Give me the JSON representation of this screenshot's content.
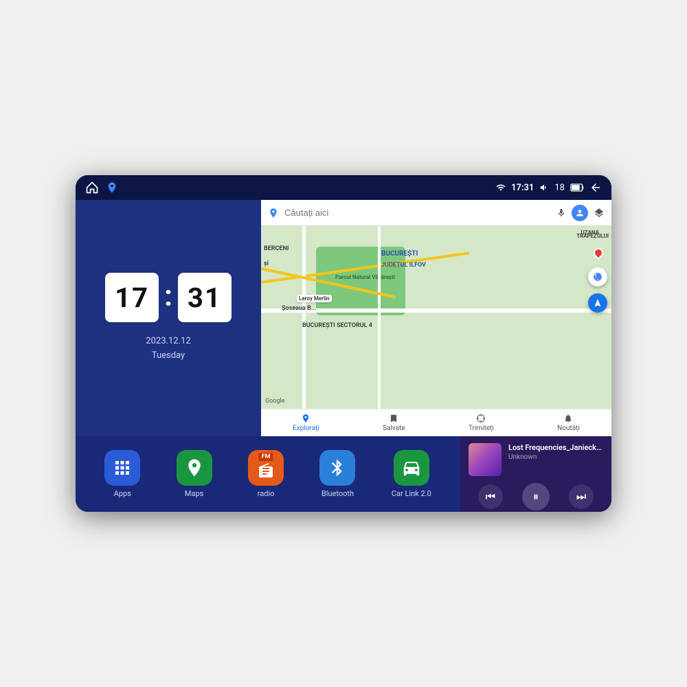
{
  "device": {
    "status_bar": {
      "time": "17:31",
      "signal_icon": "signal",
      "volume_icon": "volume",
      "battery_value": "18",
      "battery_icon": "battery",
      "back_icon": "back-arrow"
    },
    "clock": {
      "hours": "17",
      "minutes": "31",
      "date": "2023.12.12",
      "day": "Tuesday"
    },
    "map": {
      "search_placeholder": "Căutați aici",
      "bottom_items": [
        {
          "label": "Explorați",
          "icon": "pin",
          "active": true
        },
        {
          "label": "Salvate",
          "icon": "bookmark",
          "active": false
        },
        {
          "label": "Trimiteți",
          "icon": "share",
          "active": false
        },
        {
          "label": "Noutăți",
          "icon": "bell",
          "active": false
        }
      ]
    },
    "apps": [
      {
        "id": "apps",
        "label": "Apps",
        "icon": "grid"
      },
      {
        "id": "maps",
        "label": "Maps",
        "icon": "map-pin"
      },
      {
        "id": "radio",
        "label": "radio",
        "icon": "radio"
      },
      {
        "id": "bluetooth",
        "label": "Bluetooth",
        "icon": "bluetooth"
      },
      {
        "id": "carlink",
        "label": "Car Link 2.0",
        "icon": "car"
      }
    ],
    "music": {
      "title": "Lost Frequencies_Janieck Devy-...",
      "artist": "Unknown",
      "controls": {
        "prev": "⏮",
        "play": "⏸",
        "next": "⏭"
      }
    }
  }
}
